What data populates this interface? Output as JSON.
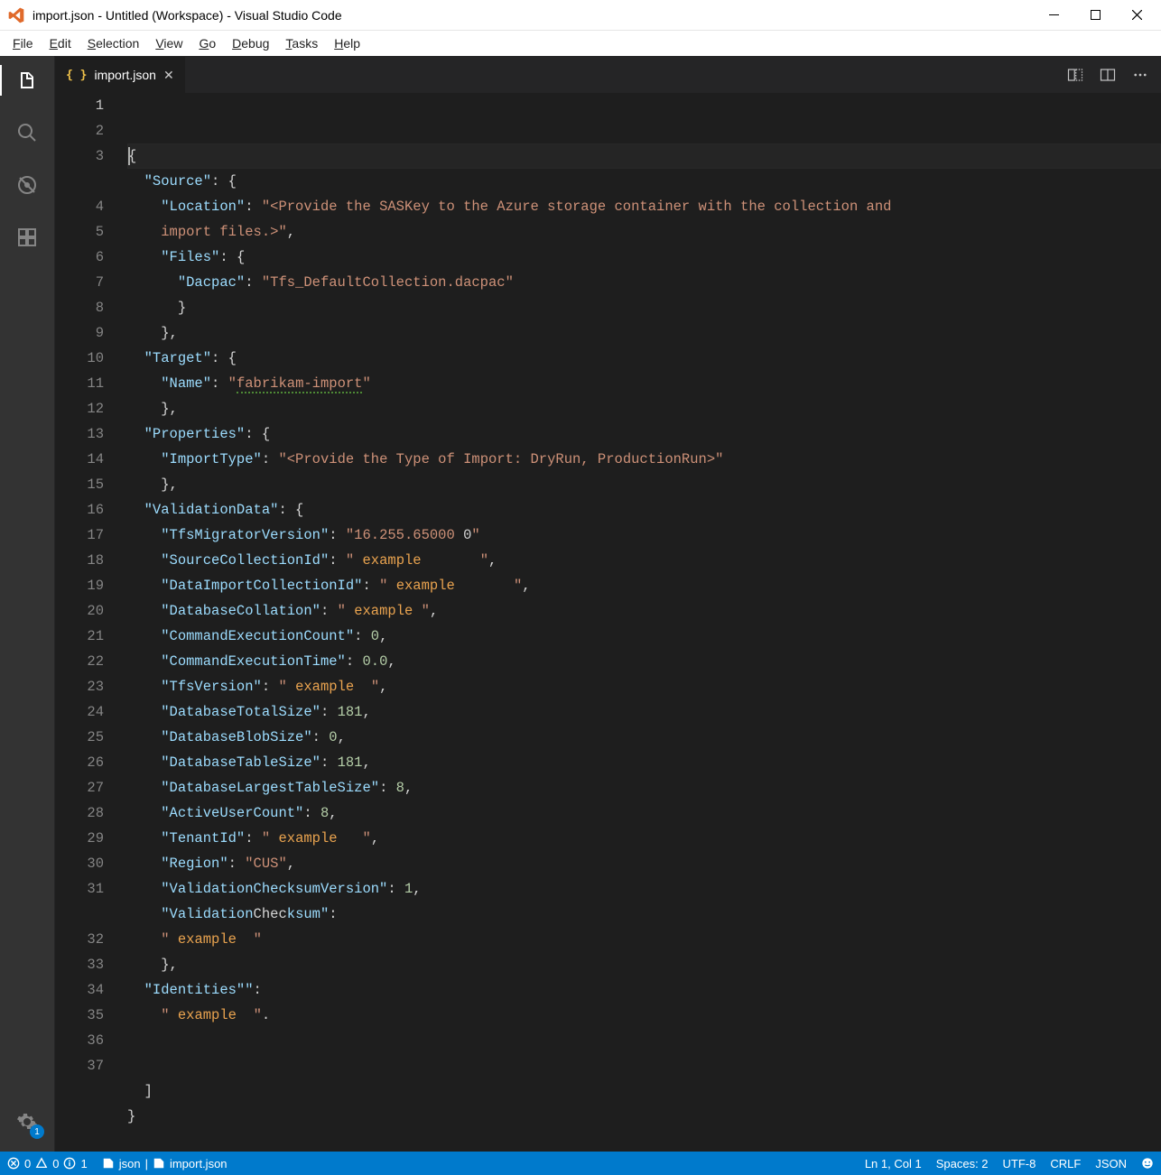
{
  "window": {
    "title": "import.json - Untitled (Workspace) - Visual Studio Code"
  },
  "menu": {
    "file": [
      "F",
      "ile"
    ],
    "edit": [
      "E",
      "dit"
    ],
    "selection": [
      "S",
      "election"
    ],
    "view": [
      "V",
      "iew"
    ],
    "go": [
      "G",
      "o"
    ],
    "debug": [
      "D",
      "ebug"
    ],
    "tasks": [
      "T",
      "asks"
    ],
    "help": [
      "H",
      "elp"
    ]
  },
  "activitybar": {
    "gear_badge": "1"
  },
  "tabs": {
    "active_file": "import.json"
  },
  "editor": {
    "line_numbers": [
      "1",
      "2",
      "3",
      "",
      "4",
      "5",
      "6",
      "7",
      "8",
      "9",
      "10",
      "11",
      "12",
      "13",
      "14",
      "15",
      "16",
      "17",
      "18",
      "19",
      "20",
      "21",
      "22",
      "23",
      "24",
      "25",
      "26",
      "27",
      "28",
      "29",
      "30",
      "31",
      "",
      "32",
      "33",
      "34",
      "35",
      "36",
      "37"
    ],
    "content": {
      "Source": {
        "Location": "<Provide the SASKey to the Azure storage container with the collection and import files.>",
        "Files": {
          "Dacpac": "Tfs_DefaultCollection.dacpac"
        }
      },
      "Target": {
        "Name": "fabrikam-import"
      },
      "Properties": {
        "ImportType": "<Provide the Type of Import: DryRun, ProductionRun>"
      },
      "ValidationData": {
        "TfsMigratorVersion": "16.255.65000 0",
        "SourceCollectionId": " example ",
        "DataImportCollectionId": " example ",
        "DatabaseCollation": " example ",
        "CommandExecutionCount": 0,
        "CommandExecutionTime": 0.0,
        "TfsVersion": " example ",
        "DatabaseTotalSize": 181,
        "DatabaseBlobSize": 0,
        "DatabaseTableSize": 181,
        "DatabaseLargestTableSize": 8,
        "ActiveUserCount": 8,
        "TenantId": " example ",
        "Region": "CUS",
        "ValidationChecksumVersion": 1,
        "ValidationChecksum": " example "
      },
      "Identities": " example ."
    }
  },
  "statusbar": {
    "errors": "0",
    "warnings": "0",
    "info": "1",
    "breadcrumb_a": "json",
    "breadcrumb_b": "import.json",
    "position": "Ln 1, Col 1",
    "indent": "Spaces: 2",
    "encoding": "UTF-8",
    "eol": "CRLF",
    "language": "JSON"
  }
}
